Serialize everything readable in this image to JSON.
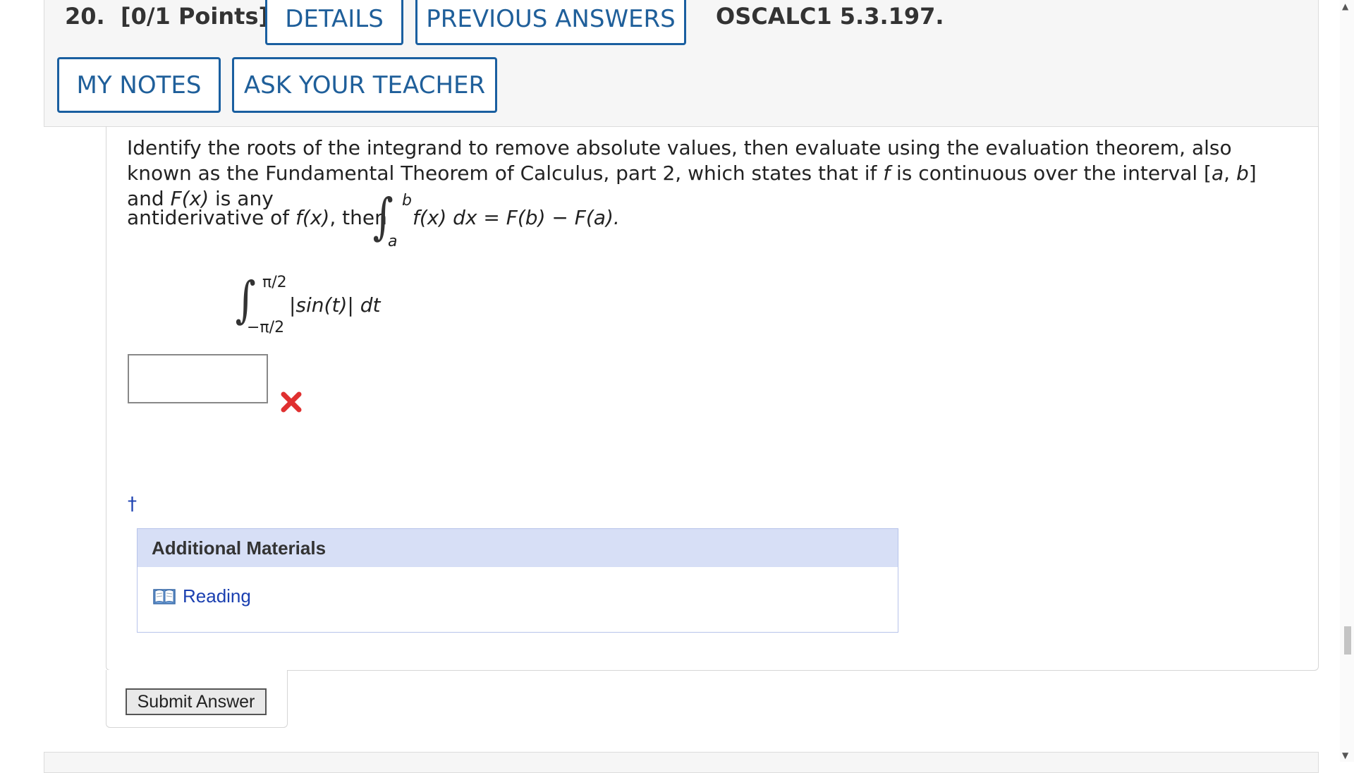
{
  "question": {
    "number": "20.",
    "points": "[0/1 Points]",
    "source": "OSCALC1 5.3.197."
  },
  "buttons": {
    "details": "DETAILS",
    "previous_answers": "PREVIOUS ANSWERS",
    "my_notes": "MY NOTES",
    "ask_teacher": "ASK YOUR TEACHER",
    "submit": "Submit Answer"
  },
  "instructions": {
    "line1": "Identify the roots of the integrand to remove absolute values, then evaluate using the evaluation theorem, also known as the Fundamental Theorem of Calculus, part 2, which states that if",
    "f": "f",
    "line1b": "is continuous over the interval [",
    "a": "a",
    "comma": ", ",
    "b": "b",
    "line1c": "] and",
    "Fx": "F(x)",
    "line1d": "is any",
    "line2a": "antiderivative of",
    "fx": "f(x)",
    "line2b": ", then",
    "upper": "b",
    "lower": "a",
    "integrand": "f(x) dx = F(b) − F(a)."
  },
  "problem": {
    "upper": "π/2",
    "lower": "−π/2",
    "integrand": "|sin(t)| dt"
  },
  "answer": {
    "value": "",
    "status": "incorrect"
  },
  "footnote": "†",
  "additional_materials": {
    "title": "Additional Materials",
    "items": [
      {
        "label": "Reading",
        "icon": "book-icon"
      }
    ]
  },
  "colors": {
    "button_border": "#1a5fa0",
    "link": "#1a3fb0",
    "materials_header": "#d7dff6",
    "error": "#e03030"
  }
}
